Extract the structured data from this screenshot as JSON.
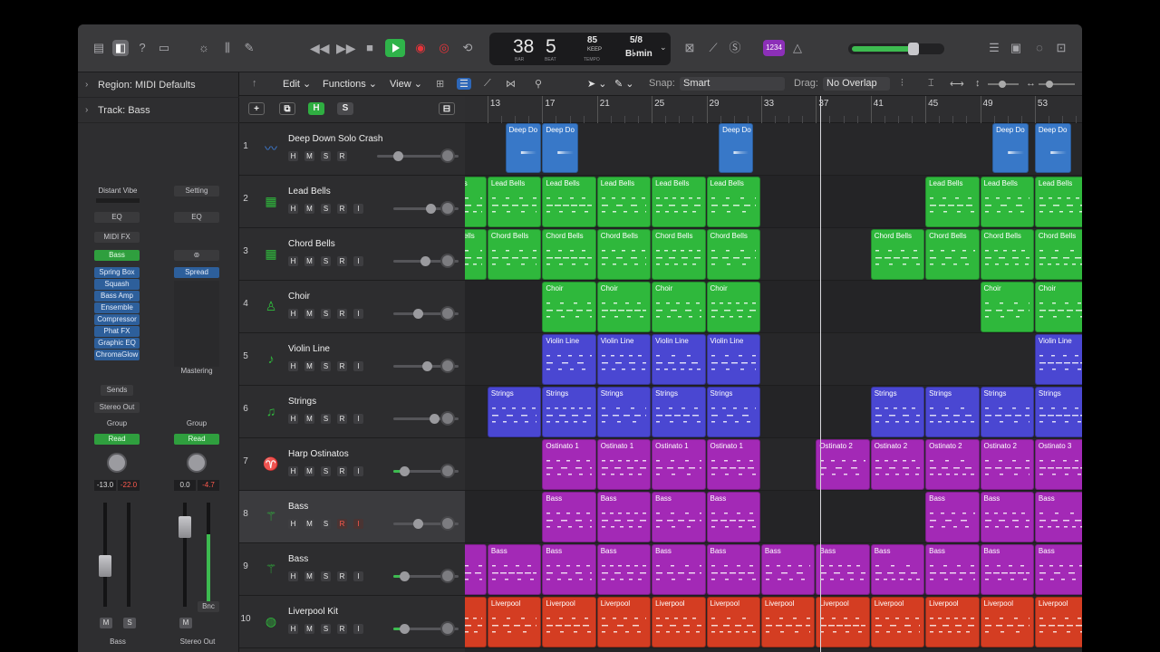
{
  "toolbar": {
    "lcd": {
      "bar": "38",
      "beat": "5",
      "bar_cap": "BAR",
      "beat_cap": "BEAT",
      "tempo": "85",
      "keep": "KEEP",
      "tempo_cap": "TEMPO",
      "signature": "5/8",
      "key": "B♭min"
    },
    "count_in": "1234"
  },
  "inspector": {
    "region_label": "Region:",
    "region_value": "MIDI Defaults",
    "track_label": "Track:",
    "track_value": "Bass"
  },
  "strip_left": {
    "preset": "Distant Vibe",
    "eq": "EQ",
    "midi_fx": "MIDI FX",
    "instrument": "Bass",
    "fx": [
      "Spring Box",
      "Squash",
      "Bass Amp",
      "Ensemble",
      "Compressor",
      "Phat FX",
      "Graphic EQ",
      "ChromaGlow"
    ],
    "sends": "Sends",
    "output": "Stereo Out",
    "group": "Group",
    "automation": "Read",
    "pan_value": "-13.0",
    "peak_value": "-22.0",
    "mute": "M",
    "solo": "S",
    "name": "Bass"
  },
  "strip_right": {
    "setting": "Setting",
    "eq": "EQ",
    "fx": "Spread",
    "mastering": "Mastering",
    "group": "Group",
    "automation": "Read",
    "pan_value": "0.0",
    "peak_value": "-4.7",
    "bounce": "Bnc",
    "mute": "M",
    "name": "Stereo Out"
  },
  "menubar": {
    "edit": "Edit",
    "functions": "Functions",
    "view": "View",
    "snap_label": "Snap:",
    "snap_value": "Smart",
    "drag_label": "Drag:",
    "drag_value": "No Overlap"
  },
  "track_header_buttons": {
    "h": "H",
    "s": "S"
  },
  "ruler": [
    "13",
    "17",
    "21",
    "25",
    "29",
    "33",
    "37",
    "41",
    "45",
    "49",
    "53"
  ],
  "tracks": [
    {
      "num": "1",
      "name": "Deep Down Solo Crash",
      "icon": "audio-waveform-icon"
    },
    {
      "num": "2",
      "name": "Lead Bells",
      "icon": "keyboard-icon"
    },
    {
      "num": "3",
      "name": "Chord Bells",
      "icon": "keyboard-icon"
    },
    {
      "num": "4",
      "name": "Choir",
      "icon": "choir-icon"
    },
    {
      "num": "5",
      "name": "Violin Line",
      "icon": "violin-icon"
    },
    {
      "num": "6",
      "name": "Strings",
      "icon": "music-note-icon"
    },
    {
      "num": "7",
      "name": "Harp Ostinatos",
      "icon": "harp-icon"
    },
    {
      "num": "8",
      "name": "Bass",
      "icon": "guitar-icon"
    },
    {
      "num": "9",
      "name": "Bass",
      "icon": "guitar-icon"
    },
    {
      "num": "10",
      "name": "Liverpool Kit",
      "icon": "drum-kit-icon"
    }
  ],
  "regions": [
    {
      "track": 0,
      "color": "blue",
      "label": "Deep Do",
      "start": 14.3,
      "len": 2.7
    },
    {
      "track": 0,
      "color": "blue",
      "label": "Deep Do",
      "start": 17,
      "len": 2.7
    },
    {
      "track": 0,
      "color": "blue",
      "label": "Deep Do",
      "start": 29.9,
      "len": 2.6
    },
    {
      "track": 0,
      "color": "blue",
      "label": "Deep Do",
      "start": 49.9,
      "len": 2.7
    },
    {
      "track": 0,
      "color": "blue",
      "label": "Deep Do",
      "start": 53,
      "len": 2.7
    },
    {
      "track": 1,
      "color": "green",
      "label": "s",
      "start": 11,
      "len": 2
    },
    {
      "track": 1,
      "color": "green",
      "label": "Lead Bells",
      "start": 13,
      "len": 4
    },
    {
      "track": 1,
      "color": "green",
      "label": "Lead Bells",
      "start": 17,
      "len": 4
    },
    {
      "track": 1,
      "color": "green",
      "label": "Lead Bells",
      "start": 21,
      "len": 4
    },
    {
      "track": 1,
      "color": "green",
      "label": "Lead Bells",
      "start": 25,
      "len": 4
    },
    {
      "track": 1,
      "color": "green",
      "label": "Lead Bells",
      "start": 29,
      "len": 4
    },
    {
      "track": 1,
      "color": "green",
      "label": "Lead Bells",
      "start": 45,
      "len": 4
    },
    {
      "track": 1,
      "color": "green",
      "label": "Lead Bells",
      "start": 49,
      "len": 4
    },
    {
      "track": 1,
      "color": "green",
      "label": "Lead Bells",
      "start": 53,
      "len": 4
    },
    {
      "track": 2,
      "color": "green",
      "label": "ells",
      "start": 11,
      "len": 2
    },
    {
      "track": 2,
      "color": "green",
      "label": "Chord Bells",
      "start": 13,
      "len": 4
    },
    {
      "track": 2,
      "color": "green",
      "label": "Chord Bells",
      "start": 17,
      "len": 4
    },
    {
      "track": 2,
      "color": "green",
      "label": "Chord Bells",
      "start": 21,
      "len": 4
    },
    {
      "track": 2,
      "color": "green",
      "label": "Chord Bells",
      "start": 25,
      "len": 4
    },
    {
      "track": 2,
      "color": "green",
      "label": "Chord Bells",
      "start": 29,
      "len": 4
    },
    {
      "track": 2,
      "color": "green",
      "label": "Chord Bells",
      "start": 41,
      "len": 4
    },
    {
      "track": 2,
      "color": "green",
      "label": "Chord Bells",
      "start": 45,
      "len": 4
    },
    {
      "track": 2,
      "color": "green",
      "label": "Chord Bells",
      "start": 49,
      "len": 4
    },
    {
      "track": 2,
      "color": "green",
      "label": "Chord Bells",
      "start": 53,
      "len": 4
    },
    {
      "track": 3,
      "color": "green",
      "label": "Choir",
      "start": 17,
      "len": 4
    },
    {
      "track": 3,
      "color": "green",
      "label": "Choir",
      "start": 21,
      "len": 4
    },
    {
      "track": 3,
      "color": "green",
      "label": "Choir",
      "start": 25,
      "len": 4
    },
    {
      "track": 3,
      "color": "green",
      "label": "Choir",
      "start": 29,
      "len": 4
    },
    {
      "track": 3,
      "color": "green",
      "label": "Choir",
      "start": 49,
      "len": 4
    },
    {
      "track": 3,
      "color": "green",
      "label": "Choir",
      "start": 53,
      "len": 4
    },
    {
      "track": 4,
      "color": "indigo",
      "label": "Violin Line",
      "start": 17,
      "len": 4
    },
    {
      "track": 4,
      "color": "indigo",
      "label": "Violin Line",
      "start": 21,
      "len": 4
    },
    {
      "track": 4,
      "color": "indigo",
      "label": "Violin Line",
      "start": 25,
      "len": 4
    },
    {
      "track": 4,
      "color": "indigo",
      "label": "Violin Line",
      "start": 29,
      "len": 4
    },
    {
      "track": 4,
      "color": "indigo",
      "label": "Violin Line",
      "start": 53,
      "len": 4
    },
    {
      "track": 5,
      "color": "indigo",
      "label": "Strings",
      "start": 13,
      "len": 4
    },
    {
      "track": 5,
      "color": "indigo",
      "label": "Strings",
      "start": 17,
      "len": 4
    },
    {
      "track": 5,
      "color": "indigo",
      "label": "Strings",
      "start": 21,
      "len": 4
    },
    {
      "track": 5,
      "color": "indigo",
      "label": "Strings",
      "start": 25,
      "len": 4
    },
    {
      "track": 5,
      "color": "indigo",
      "label": "Strings",
      "start": 29,
      "len": 4
    },
    {
      "track": 5,
      "color": "indigo",
      "label": "Strings",
      "start": 41,
      "len": 4
    },
    {
      "track": 5,
      "color": "indigo",
      "label": "Strings",
      "start": 45,
      "len": 4
    },
    {
      "track": 5,
      "color": "indigo",
      "label": "Strings",
      "start": 49,
      "len": 4
    },
    {
      "track": 5,
      "color": "indigo",
      "label": "Strings",
      "start": 53,
      "len": 4
    },
    {
      "track": 6,
      "color": "purple",
      "label": "Ostinato 1",
      "start": 17,
      "len": 4
    },
    {
      "track": 6,
      "color": "purple",
      "label": "Ostinato 1",
      "start": 21,
      "len": 4
    },
    {
      "track": 6,
      "color": "purple",
      "label": "Ostinato 1",
      "start": 25,
      "len": 4
    },
    {
      "track": 6,
      "color": "purple",
      "label": "Ostinato 1",
      "start": 29,
      "len": 4
    },
    {
      "track": 6,
      "color": "purple",
      "label": "Ostinato 2",
      "start": 37,
      "len": 4
    },
    {
      "track": 6,
      "color": "purple",
      "label": "Ostinato 2",
      "start": 41,
      "len": 4
    },
    {
      "track": 6,
      "color": "purple",
      "label": "Ostinato 2",
      "start": 45,
      "len": 4
    },
    {
      "track": 6,
      "color": "purple",
      "label": "Ostinato 2",
      "start": 49,
      "len": 4
    },
    {
      "track": 6,
      "color": "purple",
      "label": "Ostinato 3",
      "start": 53,
      "len": 4
    },
    {
      "track": 7,
      "color": "purple",
      "label": "Bass",
      "start": 17,
      "len": 4
    },
    {
      "track": 7,
      "color": "purple",
      "label": "Bass",
      "start": 21,
      "len": 4
    },
    {
      "track": 7,
      "color": "purple",
      "label": "Bass",
      "start": 25,
      "len": 4
    },
    {
      "track": 7,
      "color": "purple",
      "label": "Bass",
      "start": 29,
      "len": 4
    },
    {
      "track": 7,
      "color": "purple",
      "label": "Bass",
      "start": 45,
      "len": 4
    },
    {
      "track": 7,
      "color": "purple",
      "label": "Bass",
      "start": 49,
      "len": 4
    },
    {
      "track": 7,
      "color": "purple",
      "label": "Bass",
      "start": 53,
      "len": 4
    },
    {
      "track": 8,
      "color": "purple",
      "label": "",
      "start": 11,
      "len": 2
    },
    {
      "track": 8,
      "color": "purple",
      "label": "Bass",
      "start": 13,
      "len": 4
    },
    {
      "track": 8,
      "color": "purple",
      "label": "Bass",
      "start": 17,
      "len": 4
    },
    {
      "track": 8,
      "color": "purple",
      "label": "Bass",
      "start": 21,
      "len": 4
    },
    {
      "track": 8,
      "color": "purple",
      "label": "Bass",
      "start": 25,
      "len": 4
    },
    {
      "track": 8,
      "color": "purple",
      "label": "Bass",
      "start": 29,
      "len": 4
    },
    {
      "track": 8,
      "color": "purple",
      "label": "Bass",
      "start": 33,
      "len": 4
    },
    {
      "track": 8,
      "color": "purple",
      "label": "Bass",
      "start": 37,
      "len": 4
    },
    {
      "track": 8,
      "color": "purple",
      "label": "Bass",
      "start": 41,
      "len": 4
    },
    {
      "track": 8,
      "color": "purple",
      "label": "Bass",
      "start": 45,
      "len": 4
    },
    {
      "track": 8,
      "color": "purple",
      "label": "Bass",
      "start": 49,
      "len": 4
    },
    {
      "track": 8,
      "color": "purple",
      "label": "Bass",
      "start": 53,
      "len": 4
    },
    {
      "track": 9,
      "color": "red",
      "label": "",
      "start": 11,
      "len": 2
    },
    {
      "track": 9,
      "color": "red",
      "label": "Liverpool",
      "start": 13,
      "len": 4
    },
    {
      "track": 9,
      "color": "red",
      "label": "Liverpool",
      "start": 17,
      "len": 4
    },
    {
      "track": 9,
      "color": "red",
      "label": "Liverpool",
      "start": 21,
      "len": 4
    },
    {
      "track": 9,
      "color": "red",
      "label": "Liverpool",
      "start": 25,
      "len": 4
    },
    {
      "track": 9,
      "color": "red",
      "label": "Liverpool",
      "start": 29,
      "len": 4
    },
    {
      "track": 9,
      "color": "red",
      "label": "Liverpool",
      "start": 33,
      "len": 4
    },
    {
      "track": 9,
      "color": "red",
      "label": "Liverpool",
      "start": 37,
      "len": 4
    },
    {
      "track": 9,
      "color": "red",
      "label": "Liverpool",
      "start": 41,
      "len": 4
    },
    {
      "track": 9,
      "color": "red",
      "label": "Liverpool",
      "start": 45,
      "len": 4
    },
    {
      "track": 9,
      "color": "red",
      "label": "Liverpool",
      "start": 49,
      "len": 4
    },
    {
      "track": 9,
      "color": "red",
      "label": "Liverpool",
      "start": 53,
      "len": 4
    }
  ],
  "playhead_bar": 37.3,
  "colors": {
    "blue": "#3878c8",
    "green": "#2fb83c",
    "indigo": "#4a47d2",
    "purple": "#a329b6",
    "red": "#d43d22",
    "accent": "#2fae41"
  }
}
